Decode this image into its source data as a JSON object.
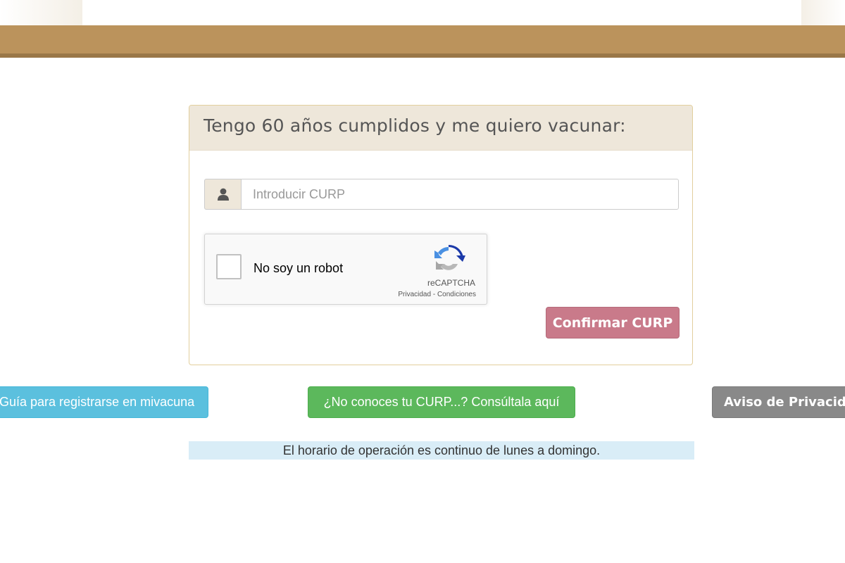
{
  "header": {
    "brand_color": "#bb935c"
  },
  "panel": {
    "title": "Tengo 60 años cumplidos y me quiero vacunar:",
    "curp_input": {
      "placeholder": "Introducir CURP",
      "value": ""
    },
    "recaptcha": {
      "label": "No soy un robot",
      "brand": "reCAPTCHA",
      "privacy_link": "Privacidad",
      "separator": " - ",
      "terms_link": "Condiciones",
      "checked": false
    },
    "confirm_button": {
      "label": "Confirmar CURP",
      "color": "#c97a8a"
    }
  },
  "actions": {
    "guide_button": {
      "label": "Guía para registrarse en mivacuna",
      "color": "#5bc0de"
    },
    "curp_lookup_button": {
      "label": "¿No conoces tu CURP...? Consúltala aquí",
      "color": "#5cb85c"
    },
    "privacy_button": {
      "label": "Aviso de Privacidad",
      "color": "#898989"
    }
  },
  "schedule_notice": {
    "text": "El horario de operación es continuo de lunes a domingo."
  },
  "icons": {
    "user": "user-icon",
    "recaptcha": "recaptcha-logo-icon"
  }
}
